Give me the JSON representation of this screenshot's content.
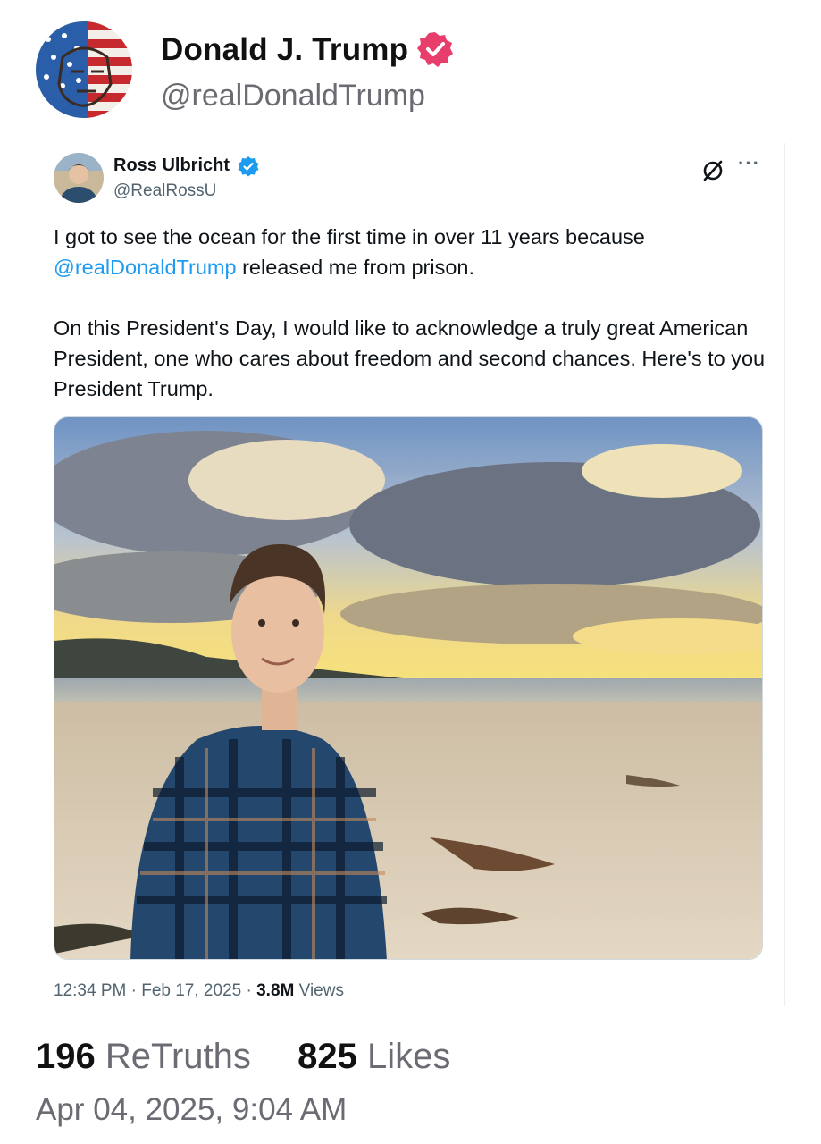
{
  "post": {
    "author_name": "Donald J. Trump",
    "author_handle": "@realDonaldTrump",
    "verified_icon": "verified-badge-icon",
    "retruths_count": "196",
    "retruths_label": "ReTruths",
    "likes_count": "825",
    "likes_label": "Likes",
    "timestamp": "Apr 04, 2025, 9:04 AM",
    "colors": {
      "verified": "#e83e6c",
      "text": "#111111",
      "muted": "#6b6b74"
    }
  },
  "embedded_tweet": {
    "author_name": "Ross Ulbricht",
    "author_handle": "@RealRossU",
    "text_line1": "I got to see the ocean for the first time in over 11 years because",
    "mention": "@realDonaldTrump",
    "text_line1_rest": " released me from prison.",
    "text_para2": "On this President's Day, I would like to acknowledge a truly great American President, one who cares about freedom and second chances. Here's to you President Trump.",
    "time": "12:34 PM",
    "date": "Feb 17, 2025",
    "views_count": "3.8M",
    "views_label": "Views",
    "sep": " · ",
    "more_label": "···",
    "colors": {
      "verified": "#1d9bf0",
      "link": "#1d9bf0",
      "muted": "#536471"
    }
  }
}
